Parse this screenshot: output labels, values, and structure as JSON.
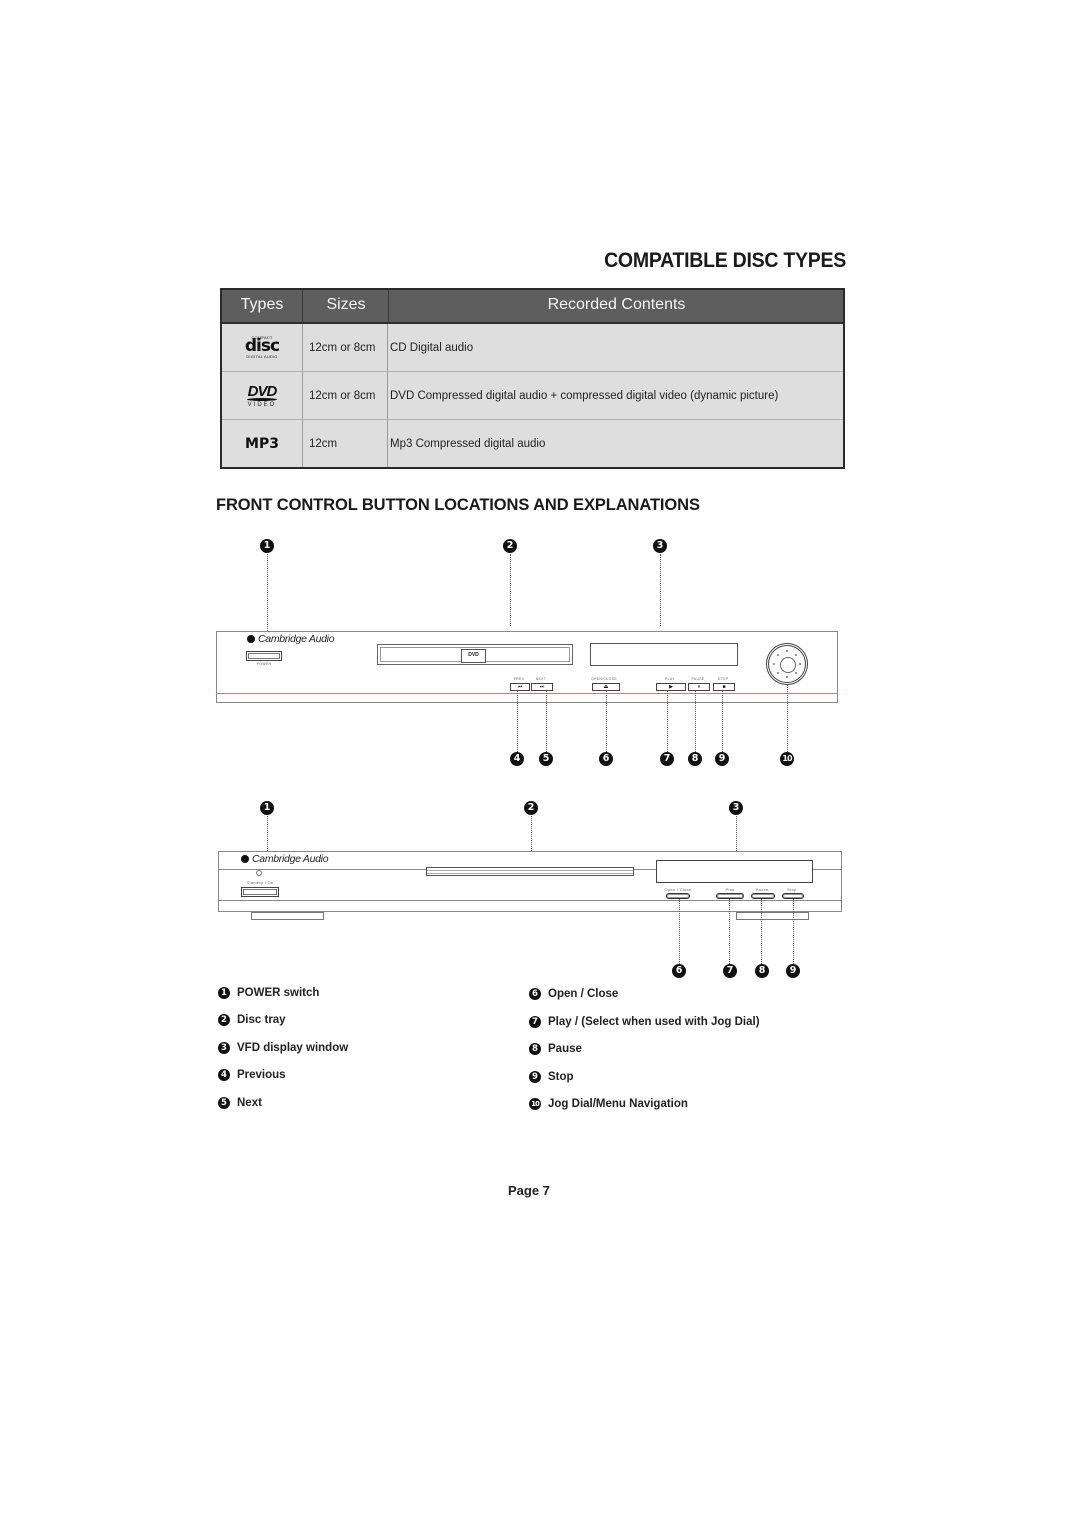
{
  "section1": {
    "title": "COMPATIBLE DISC TYPES",
    "table": {
      "headers": [
        "Types",
        "Sizes",
        "Recorded Contents"
      ],
      "rows": [
        {
          "type_icon": "compact-disc-digital-audio-logo",
          "logo_top": "COMPACT",
          "logo_main": "disc",
          "logo_bottom": "DIGITAL AUDIO",
          "size": "12cm or 8cm",
          "contents": "CD Digital audio"
        },
        {
          "type_icon": "dvd-video-logo",
          "logo_main": "DVD",
          "logo_bottom": "VIDEO",
          "size": "12cm or 8cm",
          "contents": "DVD Compressed digital audio + compressed digital video (dynamic picture)"
        },
        {
          "type_icon": "mp3-logo",
          "logo_main": "MP3",
          "size": "12cm",
          "contents": "Mp3 Compressed digital audio"
        }
      ]
    }
  },
  "section2": {
    "title": "FRONT CONTROL BUTTON LOCATIONS AND EXPLANATIONS",
    "device1": {
      "brand": "Cambridge Audio",
      "power_label": "POWER",
      "tray_logo": "DVD",
      "button_labels": {
        "prev": "PREV",
        "next": "NEXT",
        "open_close": "OPEN/CLOSE",
        "play": "PLAY",
        "pause": "PAUSE",
        "stop": "STOP"
      },
      "button_glyphs": {
        "prev": "⏮",
        "next": "⏭",
        "open_close": "⏏",
        "play": "▶",
        "pause": "⏸",
        "stop": "■"
      },
      "callouts_top": [
        "1",
        "2",
        "3"
      ],
      "callouts_bottom": [
        "4",
        "5",
        "6",
        "7",
        "8",
        "9",
        "10"
      ]
    },
    "device2": {
      "brand": "Cambridge Audio",
      "standby_label": "Standby / On",
      "button_labels": {
        "open_close": "Open / Close",
        "play": "Play",
        "pause": "Pause",
        "stop": "Stop"
      },
      "callouts_top": [
        "1",
        "2",
        "3"
      ],
      "callouts_bottom": [
        "6",
        "7",
        "8",
        "9"
      ]
    },
    "legend_left": [
      {
        "num": "1",
        "label": "POWER switch"
      },
      {
        "num": "2",
        "label": "Disc tray"
      },
      {
        "num": "3",
        "label": "VFD display window"
      },
      {
        "num": "4",
        "label": "Previous"
      },
      {
        "num": "5",
        "label": "Next"
      }
    ],
    "legend_right": [
      {
        "num": "6",
        "label": "Open / Close"
      },
      {
        "num": "7",
        "label": "Play / (Select when used with Jog Dial)"
      },
      {
        "num": "8",
        "label": "Pause"
      },
      {
        "num": "9",
        "label": "Stop"
      },
      {
        "num": "10",
        "label": "Jog Dial/Menu Navigation"
      }
    ]
  },
  "footer": {
    "page": "Page 7"
  },
  "colors": {
    "table_header_bg": "#5e5e5e",
    "table_row_bg": "#dedede",
    "callout_bg": "#111111"
  }
}
